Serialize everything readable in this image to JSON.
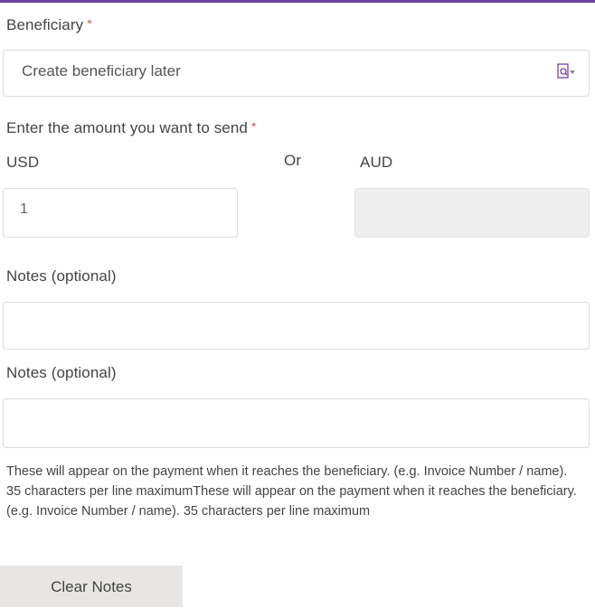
{
  "beneficiary": {
    "label": "Beneficiary",
    "required_mark": "*",
    "selected_value": "Create beneficiary later",
    "icon": "lookup-document-icon"
  },
  "amount": {
    "label": "Enter the amount you want to send",
    "required_mark": "*",
    "from_currency": "USD",
    "or_text": "Or",
    "to_currency": "AUD",
    "from_value": "1",
    "to_value": ""
  },
  "notes1": {
    "label": "Notes (optional)",
    "value": ""
  },
  "notes2": {
    "label": "Notes (optional)",
    "value": ""
  },
  "help_text": "These will appear on the payment when it reaches the beneficiary. (e.g. Invoice Number / name). 35 characters per line maximumThese will appear on the payment when it reaches the beneficiary. (e.g. Invoice Number / name). 35 characters per line maximum",
  "clear_button": "Clear Notes",
  "colors": {
    "accent_border": "#6b3fa0",
    "required": "#d9534f",
    "disabled_bg": "#eeeeee",
    "button_bg": "#e8e6e3"
  }
}
